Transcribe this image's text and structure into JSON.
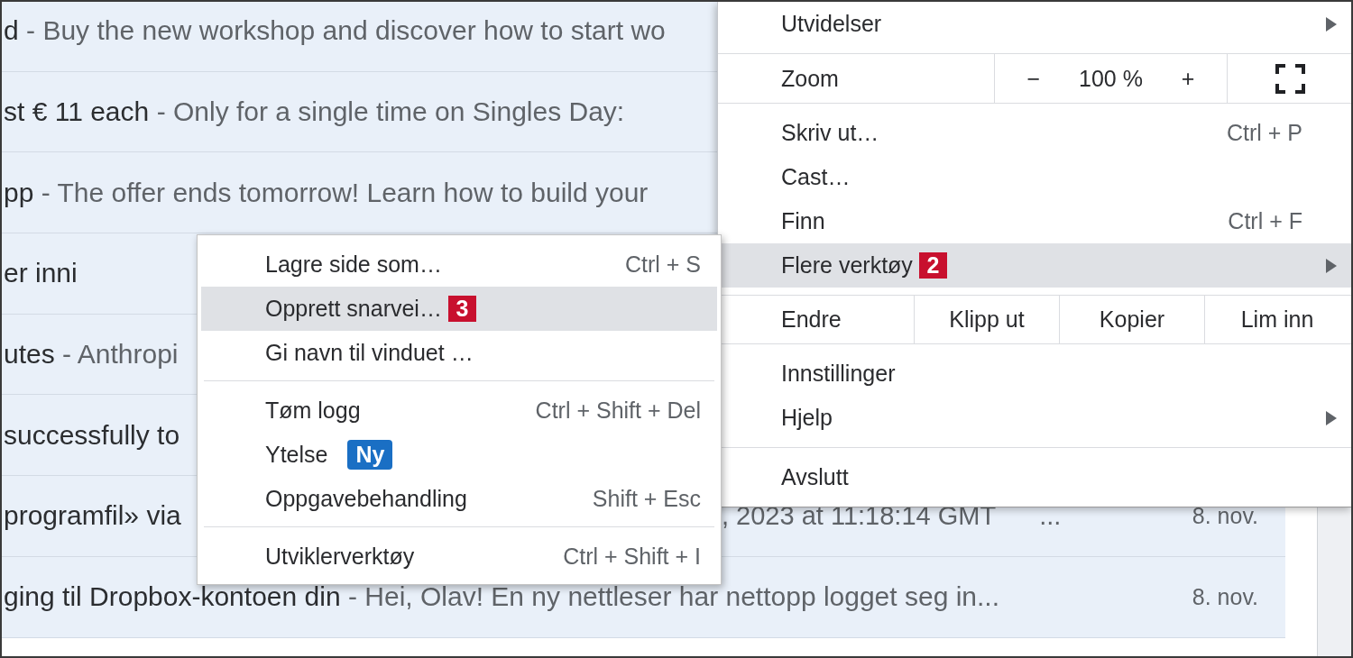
{
  "email_list": {
    "rows": [
      {
        "parts": [
          {
            "kind": "subject",
            "text": "d"
          },
          {
            "kind": "snippet",
            "text": "- Buy the new workshop and discover how to start wo"
          }
        ]
      },
      {
        "parts": [
          {
            "kind": "subject",
            "text": "st € 11 each"
          },
          {
            "kind": "snippet",
            "text": "- Only for a single time on Singles Day:"
          }
        ]
      },
      {
        "parts": [
          {
            "kind": "subject",
            "text": "pp"
          },
          {
            "kind": "snippet",
            "text": "- The offer ends tomorrow! Learn how to build your"
          }
        ]
      },
      {
        "parts": [
          {
            "kind": "subject",
            "text": "er inni"
          }
        ]
      },
      {
        "parts": [
          {
            "kind": "subject",
            "text": "utes"
          },
          {
            "kind": "snippet",
            "text": "- Anthropi"
          }
        ]
      },
      {
        "parts": [
          {
            "kind": "subject",
            "text": "successfully to"
          }
        ]
      },
      {
        "parts": [
          {
            "kind": "subject",
            "text": "programfil» via"
          }
        ],
        "tail": [
          {
            "kind": "snippet",
            "text": ", 2023 at 11:18:14 GMT"
          },
          {
            "kind": "snippet",
            "text": "..."
          }
        ],
        "date": "8. nov."
      },
      {
        "parts": [
          {
            "kind": "subject",
            "text": "ging til Dropbox-kontoen din"
          },
          {
            "kind": "snippet",
            "text": "- Hei, Olav! En ny nettleser har nettopp logget seg in..."
          }
        ],
        "date": "8. nov."
      }
    ]
  },
  "main_menu": {
    "sections": [
      {
        "items": [
          {
            "kind": "item",
            "label": "Utvidelser",
            "submenu": true,
            "selected": false
          }
        ]
      },
      {
        "items": [
          {
            "kind": "zoom",
            "label": "Zoom",
            "minus": "−",
            "value": "100 %",
            "plus": "+"
          }
        ]
      },
      {
        "items": [
          {
            "kind": "item",
            "label": "Skriv ut…",
            "shortcut": "Ctrl + P",
            "submenu": false,
            "selected": false
          },
          {
            "kind": "item",
            "label": "Cast…",
            "submenu": false,
            "selected": false
          },
          {
            "kind": "item",
            "label": "Finn",
            "shortcut": "Ctrl + F",
            "submenu": false,
            "selected": false
          },
          {
            "kind": "item",
            "label": "Flere verktøy",
            "step": "2",
            "submenu": true,
            "selected": true
          }
        ]
      },
      {
        "items": [
          {
            "kind": "edit",
            "label": "Endre",
            "actions": [
              "Klipp ut",
              "Kopier",
              "Lim inn"
            ]
          }
        ]
      },
      {
        "items": [
          {
            "kind": "item",
            "label": "Innstillinger",
            "submenu": false,
            "selected": false
          },
          {
            "kind": "item",
            "label": "Hjelp",
            "submenu": true,
            "selected": false
          }
        ]
      },
      {
        "items": [
          {
            "kind": "item",
            "label": "Avslutt",
            "submenu": false,
            "selected": false
          }
        ]
      }
    ]
  },
  "tools_submenu": {
    "sections": [
      {
        "items": [
          {
            "kind": "item",
            "label": "Lagre side som…",
            "shortcut": "Ctrl + S",
            "selected": false
          },
          {
            "kind": "item",
            "label": "Opprett snarvei…",
            "step": "3",
            "selected": true
          },
          {
            "kind": "item",
            "label": "Gi navn til vinduet …",
            "selected": false
          }
        ]
      },
      {
        "items": [
          {
            "kind": "item",
            "label": "Tøm logg",
            "shortcut": "Ctrl + Shift + Del",
            "selected": false
          },
          {
            "kind": "item",
            "label": "Ytelse",
            "tag": "Ny",
            "selected": false
          },
          {
            "kind": "item",
            "label": "Oppgavebehandling",
            "shortcut": "Shift + Esc",
            "selected": false
          }
        ]
      },
      {
        "items": [
          {
            "kind": "item",
            "label": "Utviklerverktøy",
            "shortcut": "Ctrl + Shift + I",
            "selected": false
          }
        ]
      }
    ]
  }
}
